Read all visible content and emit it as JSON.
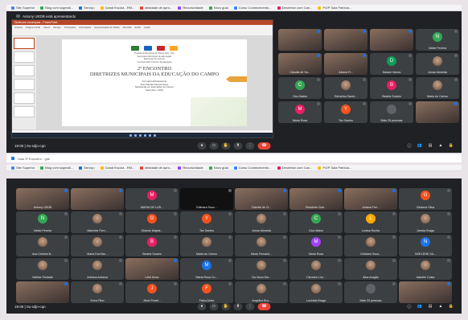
{
  "bookmarks": [
    {
      "label": "Site Superior",
      "color": "#4285f4"
    },
    {
      "label": "Blog com sugestõ...",
      "color": "#34a853"
    },
    {
      "label": "Serviço",
      "color": "#1a73e8"
    },
    {
      "label": "Canal Escola - RM...",
      "color": "#fbbc04"
    },
    {
      "label": "atividade de apro...",
      "color": "#ea4335"
    },
    {
      "label": "Recursividade",
      "color": "#a142f4"
    },
    {
      "label": "Novo guia",
      "color": "#34a853"
    },
    {
      "label": "Curso Conhecimento...",
      "color": "#4285f4"
    },
    {
      "label": "Desenhar com Can...",
      "color": "#e91e63"
    },
    {
      "label": "Pr2P Sala Patricia...",
      "color": "#fbbc04"
    }
  ],
  "presenting": "Antony UEDB está apresentando",
  "slide": {
    "lines": [
      "Prefeitura Municipal de Santa Inês - MA",
      "Secretaria Municipal de Educação",
      "Educação do Campo",
      "Coordenação Técnico-Pedagógica"
    ],
    "heading1": "2º ENCONTRO",
    "heading2": "DIRETRIZES MUNICIPAIS DA EDUCAÇÃO DO CAMPO",
    "sub": [
      "Formadora/Palestrante",
      "Ana Cláudia Pereira Alves",
      "Mestranda em Educação do Campo",
      "Setembro / 2021"
    ]
  },
  "ppt": {
    "title": "Diretrizes municipais - PowerPoint",
    "tabs": [
      "Arquivo",
      "Página Inicial",
      "Inserir",
      "Design",
      "Transições",
      "Animações",
      "Apresentação de Slides",
      "Revisão",
      "Exibir",
      "Ajuda"
    ],
    "status": [
      "Slide 1 de 22",
      "Português (Brasil)",
      "Acessibilidade: Investigar"
    ]
  },
  "participants_top": [
    {
      "name": "",
      "type": "video"
    },
    {
      "name": "",
      "type": "video"
    },
    {
      "name": "",
      "type": "video"
    },
    {
      "name": "Neide Pereira",
      "initial": "N",
      "color": "#34a853"
    },
    {
      "name": "Cláudia de Sa...",
      "type": "video"
    },
    {
      "name": "Juliana Fr...",
      "type": "video"
    },
    {
      "name": "Daiane Neves",
      "initial": "D",
      "color": "#0f9d58"
    },
    {
      "name": "Jomar Almeida",
      "type": "photo"
    },
    {
      "name": "Cica Matos",
      "initial": "C",
      "color": "#34a853"
    },
    {
      "name": "Edivalma Sandr...",
      "type": "photo"
    },
    {
      "name": "Beatriz Soares",
      "initial": "B",
      "color": "#e91e63"
    },
    {
      "name": "Maria do Carmo",
      "type": "photo"
    },
    {
      "name": "Maria Rosa",
      "initial": "M",
      "color": "#e91e63"
    },
    {
      "name": "Tan Santos",
      "initial": "Y",
      "color": "#f4511e"
    },
    {
      "name": "Mais 25 pessoas",
      "type": "more"
    },
    {
      "name": "",
      "type": "video"
    }
  ],
  "participants_bottom": [
    {
      "name": "Antony UEDB",
      "type": "video"
    },
    {
      "name": "",
      "type": "video"
    },
    {
      "name": "MARIA DE LUR...",
      "initial": "M",
      "color": "#e91e63"
    },
    {
      "name": "Edimara Souz...",
      "type": "black"
    },
    {
      "name": "Cláudia de Cl...",
      "type": "video"
    },
    {
      "name": "Elisabete Clari...",
      "type": "video"
    },
    {
      "name": "Juliana Frei...",
      "type": "video"
    },
    {
      "name": "Girlaene Silva",
      "initial": "G",
      "color": "#f4511e"
    },
    {
      "name": "Neide Pereira",
      "initial": "N",
      "color": "#34a853"
    },
    {
      "name": "Marinete Fern...",
      "type": "photo"
    },
    {
      "name": "Gislene Majest...",
      "initial": "G",
      "color": "#f4511e"
    },
    {
      "name": "Tan Santos",
      "initial": "Y",
      "color": "#f4511e"
    },
    {
      "name": "Jomar Almeida",
      "type": "photo"
    },
    {
      "name": "Cica Matos",
      "initial": "C",
      "color": "#34a853"
    },
    {
      "name": "Louisa Rocha",
      "initial": "L",
      "color": "#f9ab00"
    },
    {
      "name": "Janicia Braga",
      "type": "photo"
    },
    {
      "name": "Ana Cristina B...",
      "type": "photo"
    },
    {
      "name": "Maria Eva Bar...",
      "type": "photo"
    },
    {
      "name": "Beatriz Soares",
      "initial": "B",
      "color": "#e91e63"
    },
    {
      "name": "Maria do Carmo",
      "type": "photo"
    },
    {
      "name": "Maria Fernand...",
      "type": "photo"
    },
    {
      "name": "Maria Rosa",
      "initial": "M",
      "color": "#a142f4"
    },
    {
      "name": "Cristiane Sous...",
      "type": "photo"
    },
    {
      "name": "NOELENE SA...",
      "initial": "N",
      "color": "#1a73e8"
    },
    {
      "name": "Valéria Trindade",
      "type": "photo"
    },
    {
      "name": "Adriana Adriana",
      "type": "photo"
    },
    {
      "name": "Léidi Alves",
      "type": "video"
    },
    {
      "name": "Maria Rosa Co...",
      "initial": "M",
      "color": "#1a73e8"
    },
    {
      "name": "Cia Nova Dor...",
      "type": "photo"
    },
    {
      "name": "Cleonice Lim...",
      "type": "photo"
    },
    {
      "name": "Alna Aragão",
      "type": "photo"
    },
    {
      "name": "Isabelle Costa",
      "type": "photo"
    },
    {
      "name": "",
      "type": "video"
    },
    {
      "name": "Eriza Filho",
      "type": "photo"
    },
    {
      "name": "Jânio Ferrei...",
      "initial": "J",
      "color": "#f4511e"
    },
    {
      "name": "Fábio Alves",
      "initial": "F",
      "color": "#f4511e"
    },
    {
      "name": "Angélica Bra...",
      "type": "photo"
    },
    {
      "name": "Lucinéia Braga",
      "type": "photo"
    },
    {
      "name": "Mais 33 pessoas",
      "type": "more"
    },
    {
      "name": "",
      "type": "video"
    }
  ],
  "meeting_top": "19:05 | rtu-sdjn-cqn",
  "meeting_bottom": "19:08 | rtu-sdjn-cqn",
  "extra_strip": "Sala 3º Encontro - gde",
  "colors": {
    "meet_bg": "#202124",
    "tile_bg": "#3c4043",
    "end_call": "#ea4335",
    "accent": "#1a73e8"
  }
}
